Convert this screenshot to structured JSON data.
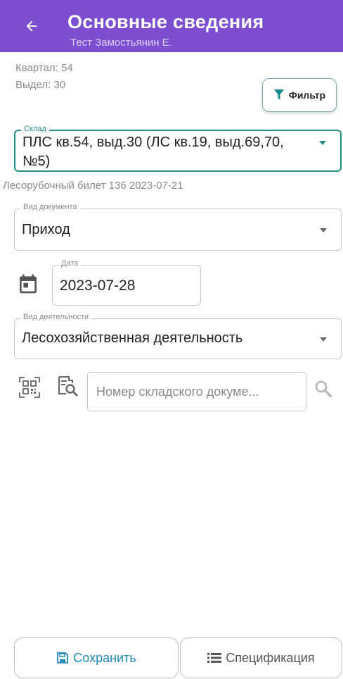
{
  "header": {
    "title": "Основные сведения",
    "subtitle": "Тест Замостьянин Е."
  },
  "location": {
    "quarter": "Квартал: 54",
    "plot": "Выдел: 30"
  },
  "filter": {
    "label": "Фильтр"
  },
  "warehouse": {
    "label": "Склад",
    "value_line1": "ПЛС кв.54, выд.30 (ЛС кв.19, выд.69,70,",
    "value_line2": "№5)"
  },
  "permit": {
    "text": "Лесорубочный билет 136 2023-07-21"
  },
  "doc_type": {
    "label": "Вид документа",
    "value": "Приход"
  },
  "date": {
    "label": "Дата",
    "value": "2023-07-28"
  },
  "activity": {
    "label": "Вид деятельности",
    "value": "Лесохозяйственная деятельность"
  },
  "doc_search": {
    "placeholder": "Номер складского докуме..."
  },
  "actions": {
    "save_label": "Сохранить",
    "spec_label": "Спецификация"
  },
  "colors": {
    "primary": "#7c4fd0",
    "accent": "#2a8a8a",
    "save_text": "#1f8ab8"
  }
}
